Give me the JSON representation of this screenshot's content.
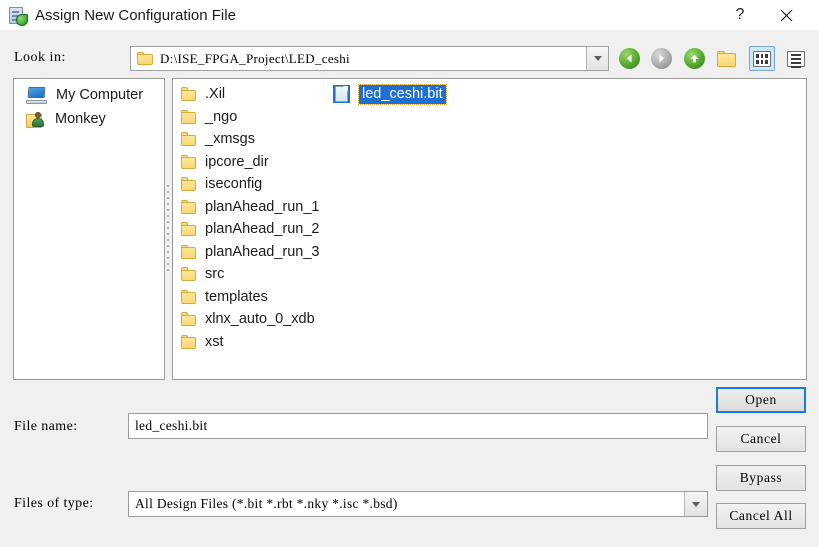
{
  "window": {
    "title": "Assign New Configuration File",
    "icon": "config-file-icon",
    "help_label": "?",
    "close_label": "✕"
  },
  "lookin": {
    "label": "Look in:",
    "path": "D:\\ISE_FPGA_Project\\LED_ceshi",
    "folder_icon": "folder-icon",
    "dropdown_icon": "chevron-down-icon"
  },
  "toolbar": {
    "back": "back-icon",
    "forward": "forward-icon",
    "up": "up-one-level-icon",
    "new_folder": "new-folder-icon",
    "list_view": "list-view-icon",
    "detail_view": "detail-view-icon"
  },
  "sidebar": {
    "items": [
      {
        "label": "My Computer",
        "icon": "computer-icon"
      },
      {
        "label": "Monkey",
        "icon": "user-folder-icon"
      }
    ]
  },
  "filelist": {
    "column1": [
      {
        "name": ".Xil",
        "type": "folder"
      },
      {
        "name": "_ngo",
        "type": "folder"
      },
      {
        "name": "_xmsgs",
        "type": "folder"
      },
      {
        "name": "ipcore_dir",
        "type": "folder"
      },
      {
        "name": "iseconfig",
        "type": "folder"
      },
      {
        "name": "planAhead_run_1",
        "type": "folder"
      },
      {
        "name": "planAhead_run_2",
        "type": "folder"
      },
      {
        "name": "planAhead_run_3",
        "type": "folder"
      },
      {
        "name": "src",
        "type": "folder"
      },
      {
        "name": "templates",
        "type": "folder"
      },
      {
        "name": "xlnx_auto_0_xdb",
        "type": "folder"
      },
      {
        "name": "xst",
        "type": "folder"
      }
    ],
    "column2": [
      {
        "name": "led_ceshi.bit",
        "type": "file",
        "selected": true
      }
    ],
    "selection_color": "#1f6fd0",
    "focus_outline_color": "#d89a30"
  },
  "form": {
    "filename_label": "File name:",
    "filename_value": "led_ceshi.bit",
    "filetype_label": "Files of type:",
    "filetype_value": "All Design Files (*.bit *.rbt *.nky *.isc *.bsd)"
  },
  "buttons": {
    "open": "Open",
    "cancel": "Cancel",
    "bypass": "Bypass",
    "cancel_all": "Cancel All",
    "default_focus_color": "#1a7ae0"
  },
  "colors": {
    "window_background": "#f0f0f0",
    "titlebar_background": "#ffffff",
    "panel_background": "#ffffff",
    "border": "#9b9b9b"
  }
}
